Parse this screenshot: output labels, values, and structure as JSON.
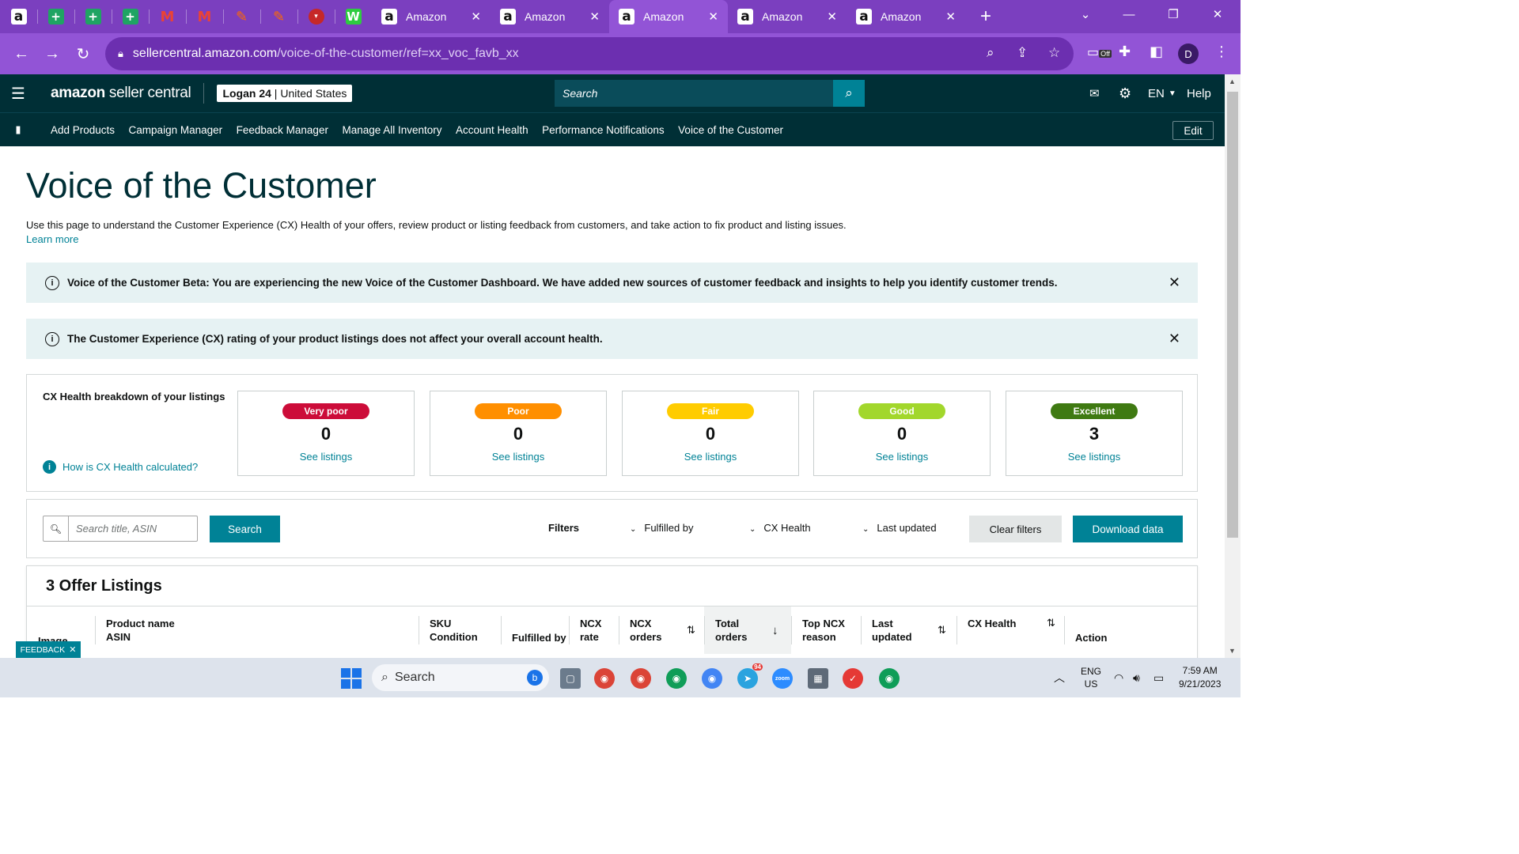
{
  "browser": {
    "tabs": [
      {
        "title": "Amazon",
        "active": false
      },
      {
        "title": "Amazon",
        "active": false
      },
      {
        "title": "Amazon",
        "active": true
      },
      {
        "title": "Amazon",
        "active": false
      },
      {
        "title": "Amazon",
        "active": false
      }
    ],
    "url_host": "sellercentral.amazon.com",
    "url_path": "/voice-of-the-customer/ref=xx_voc_favb_xx",
    "extension_badge": "Off",
    "profile_initial": "D"
  },
  "header": {
    "logo_bold": "amazon",
    "logo_rest": " seller central",
    "account_name": "Logan 24",
    "account_region": "United States",
    "search_placeholder": "Search",
    "language": "EN",
    "help": "Help"
  },
  "nav": {
    "links": [
      "Add Products",
      "Campaign Manager",
      "Feedback Manager",
      "Manage All Inventory",
      "Account Health",
      "Performance Notifications",
      "Voice of the Customer"
    ],
    "edit": "Edit"
  },
  "page": {
    "title": "Voice of the Customer",
    "description": "Use this page to understand the Customer Experience (CX) Health of your offers, review product or listing feedback from customers, and take action to fix product and listing issues.",
    "learn_more": "Learn more",
    "alert_beta": "Voice of the Customer Beta: You are experiencing the new Voice of the Customer Dashboard. We have added new sources of customer feedback and insights to help you identify customer trends.",
    "alert_cx": "The Customer Experience (CX) rating of your product listings does not affect your overall account health."
  },
  "cx": {
    "label": "CX Health breakdown of your listings",
    "how": "How is CX Health calculated?",
    "cards": [
      {
        "rating": "Very poor",
        "count": "0",
        "link": "See listings",
        "color": "#cc0c39",
        "text": "#ffffff"
      },
      {
        "rating": "Poor",
        "count": "0",
        "link": "See listings",
        "color": "#ff8f00",
        "text": "#ffffff"
      },
      {
        "rating": "Fair",
        "count": "0",
        "link": "See listings",
        "color": "#ffcc00",
        "text": "#ffffff"
      },
      {
        "rating": "Good",
        "count": "0",
        "link": "See listings",
        "color": "#a2d72c",
        "text": "#ffffff"
      },
      {
        "rating": "Excellent",
        "count": "3",
        "link": "See listings",
        "color": "#3f7a12",
        "text": "#ffffff"
      }
    ]
  },
  "filters": {
    "search_placeholder": "Search title, ASIN",
    "search_button": "Search",
    "filters_label": "Filters",
    "fulfilled_by": "Fulfilled by",
    "cx_health": "CX Health",
    "last_updated": "Last updated",
    "clear": "Clear filters",
    "download": "Download data"
  },
  "offers": {
    "title": "3 Offer Listings",
    "columns": {
      "image": "Image",
      "product_line1": "Product name",
      "product_line2": "ASIN",
      "sku_line1": "SKU",
      "sku_line2": "Condition",
      "fulfilled": "Fulfilled by",
      "ncx_rate_line1": "NCX",
      "ncx_rate_line2": "rate",
      "ncx_orders_line1": "NCX",
      "ncx_orders_line2": "orders",
      "total_line1": "Total",
      "total_line2": "orders",
      "topncx_line1": "Top NCX",
      "topncx_line2": "reason",
      "last_line1": "Last",
      "last_line2": "updated",
      "cx_health": "CX Health",
      "action": "Action"
    }
  },
  "feedback": "FEEDBACK",
  "taskbar": {
    "search": "Search",
    "lang_line1": "ENG",
    "lang_line2": "US",
    "time": "7:59 AM",
    "date": "9/21/2023",
    "telegram_badge": "94"
  }
}
